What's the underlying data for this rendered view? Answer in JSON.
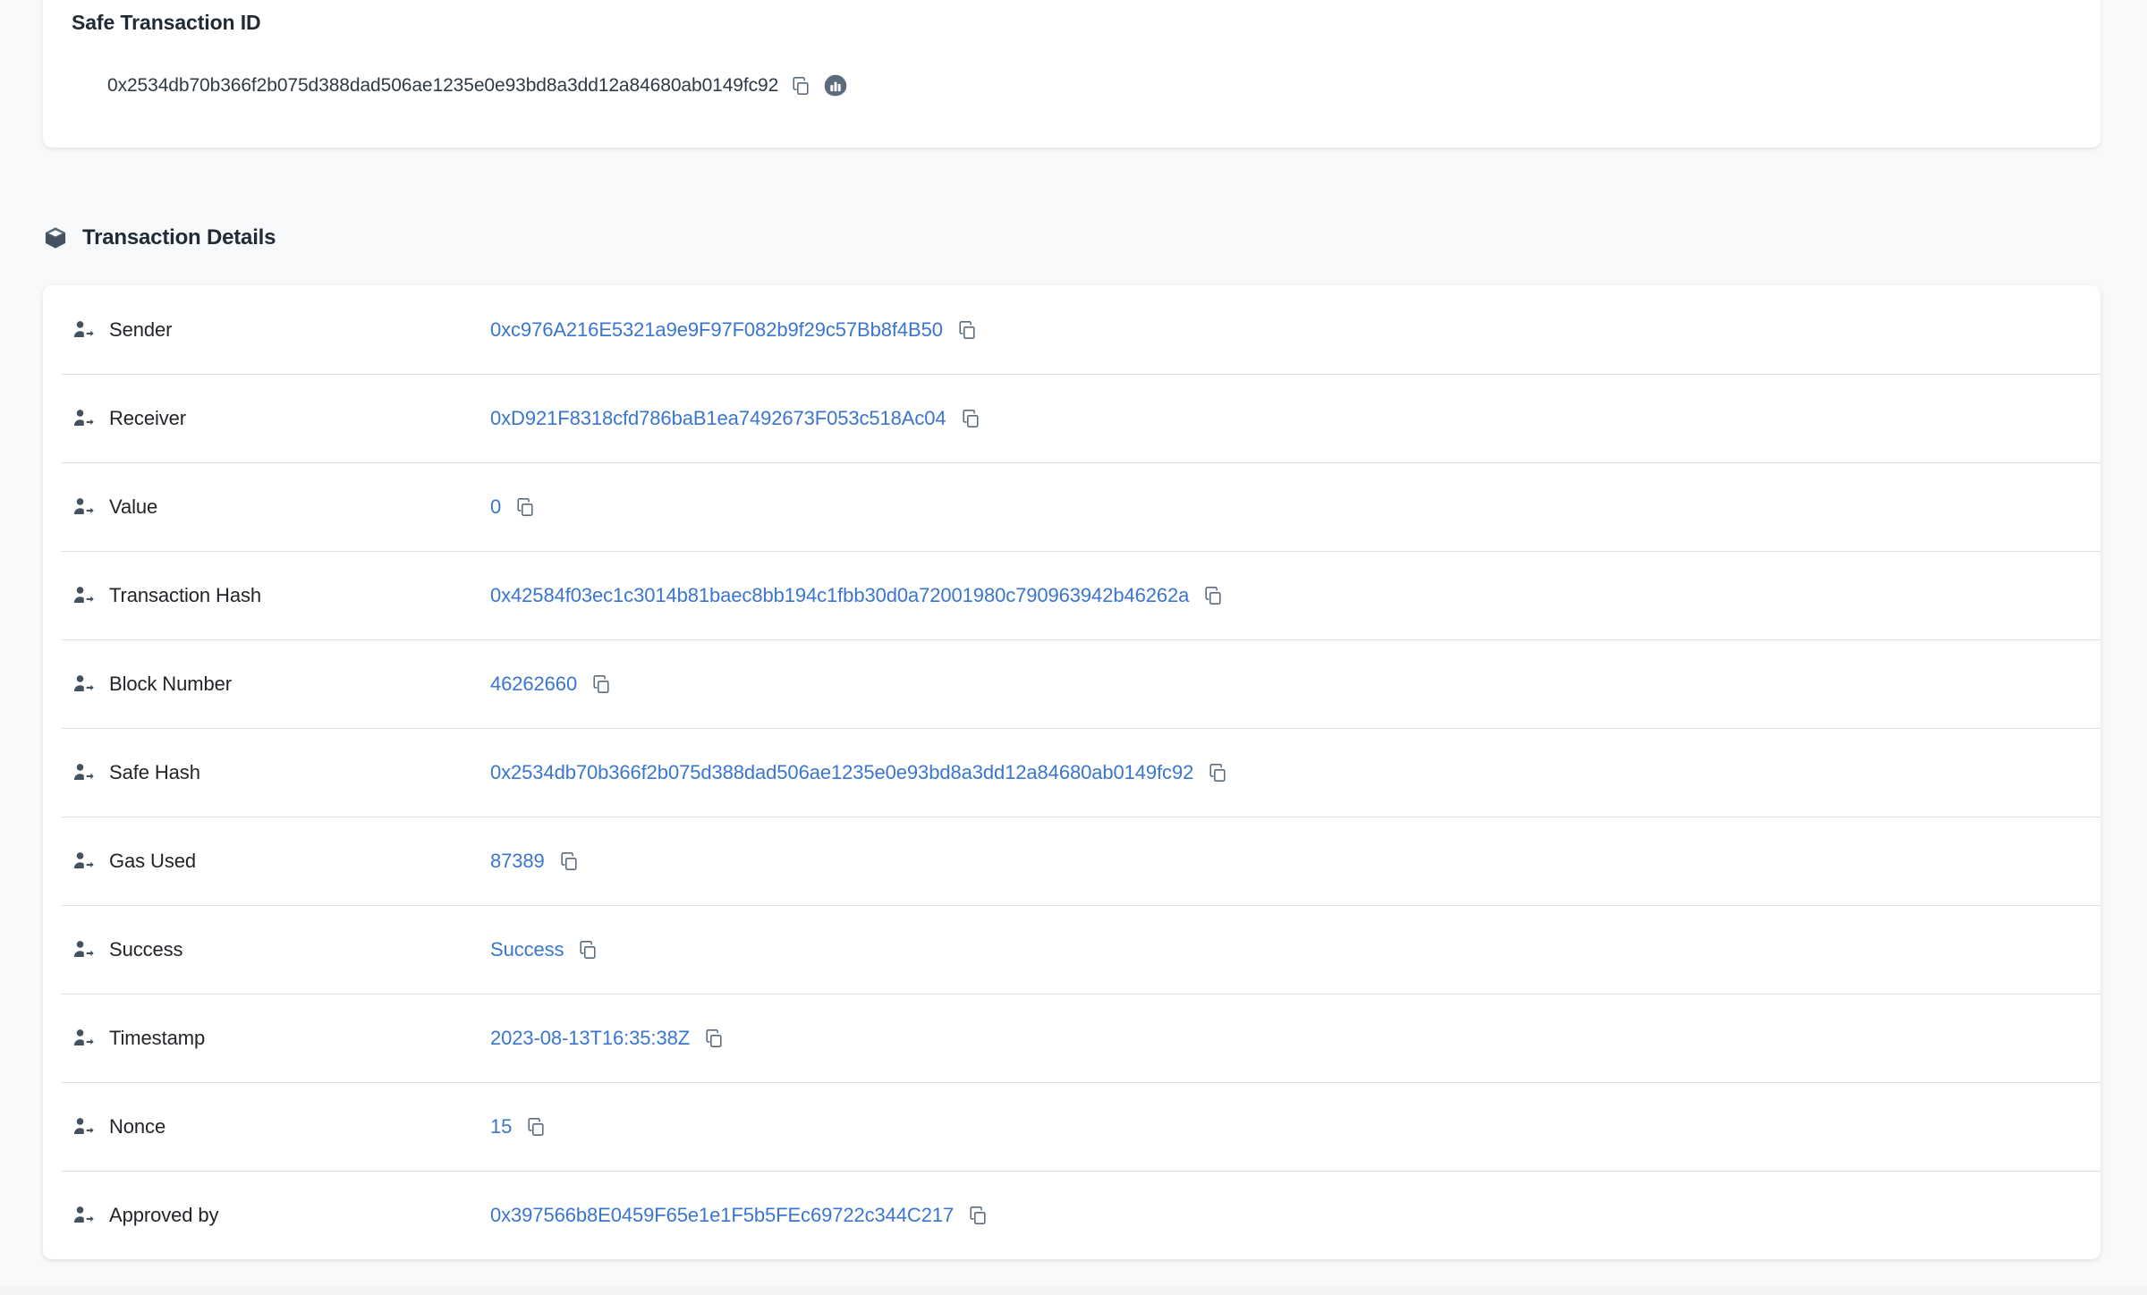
{
  "top_card": {
    "title": "Safe Transaction ID",
    "value": "0x2534db70b366f2b075d388dad506ae1235e0e93bd8a3dd12a84680ab0149fc92",
    "copy_icon": "copy-icon",
    "explorer_icon": "block-explorer-icon"
  },
  "section": {
    "icon": "cube-icon",
    "title": "Transaction Details"
  },
  "colors": {
    "link": "#3a76cf",
    "text": "#212529",
    "heading": "#212b36",
    "page_background": "#f8f9fa",
    "card_background": "#ffffff",
    "divider": "#dee2e6",
    "icon": "#44525f"
  },
  "details": {
    "row_icon": "person-transfer-icon",
    "copy_icon": "copy-icon",
    "rows": [
      {
        "label": "Sender",
        "value": "0xc976A216E5321a9e9F97F082b9f29c57Bb8f4B50"
      },
      {
        "label": "Receiver",
        "value": "0xD921F8318cfd786baB1ea7492673F053c518Ac04"
      },
      {
        "label": "Value",
        "value": "0"
      },
      {
        "label": "Transaction Hash",
        "value": "0x42584f03ec1c3014b81baec8bb194c1fbb30d0a72001980c790963942b46262a"
      },
      {
        "label": "Block Number",
        "value": "46262660"
      },
      {
        "label": "Safe Hash",
        "value": "0x2534db70b366f2b075d388dad506ae1235e0e93bd8a3dd12a84680ab0149fc92"
      },
      {
        "label": "Gas Used",
        "value": "87389"
      },
      {
        "label": "Success",
        "value": "Success"
      },
      {
        "label": "Timestamp",
        "value": "2023-08-13T16:35:38Z"
      },
      {
        "label": "Nonce",
        "value": "15"
      },
      {
        "label": "Approved by",
        "value": "0x397566b8E0459F65e1e1F5b5FEc69722c344C217"
      }
    ]
  }
}
